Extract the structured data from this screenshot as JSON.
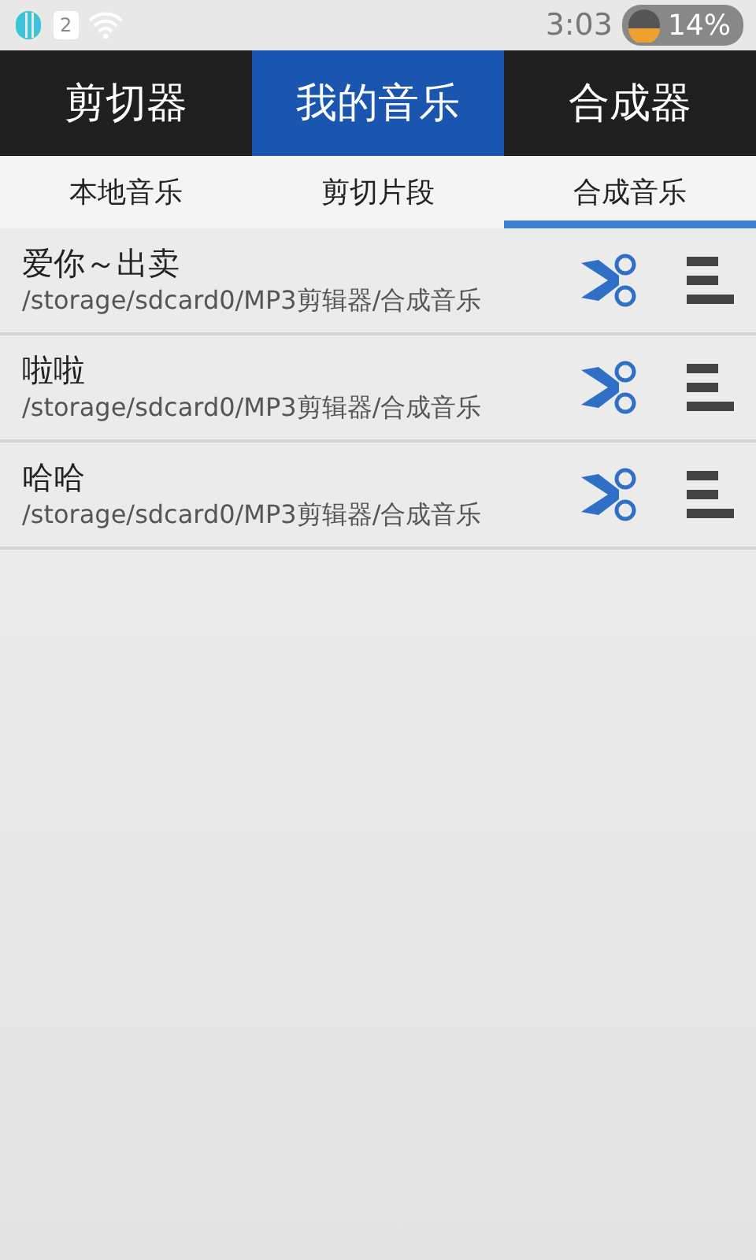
{
  "status_bar": {
    "sim_badge": "2",
    "time": "3:03",
    "battery": "14%"
  },
  "tabs": [
    {
      "label": "剪切器",
      "selected": false
    },
    {
      "label": "我的音乐",
      "selected": true
    },
    {
      "label": "合成器",
      "selected": false
    }
  ],
  "sub_tabs": [
    {
      "label": "本地音乐",
      "selected": false
    },
    {
      "label": "剪切片段",
      "selected": false
    },
    {
      "label": "合成音乐",
      "selected": true
    }
  ],
  "songs": [
    {
      "title": "爱你～出卖",
      "path": "/storage/sdcard0/MP3剪辑器/合成音乐"
    },
    {
      "title": "啦啦",
      "path": "/storage/sdcard0/MP3剪辑器/合成音乐"
    },
    {
      "title": "哈哈",
      "path": "/storage/sdcard0/MP3剪辑器/合成音乐"
    }
  ]
}
